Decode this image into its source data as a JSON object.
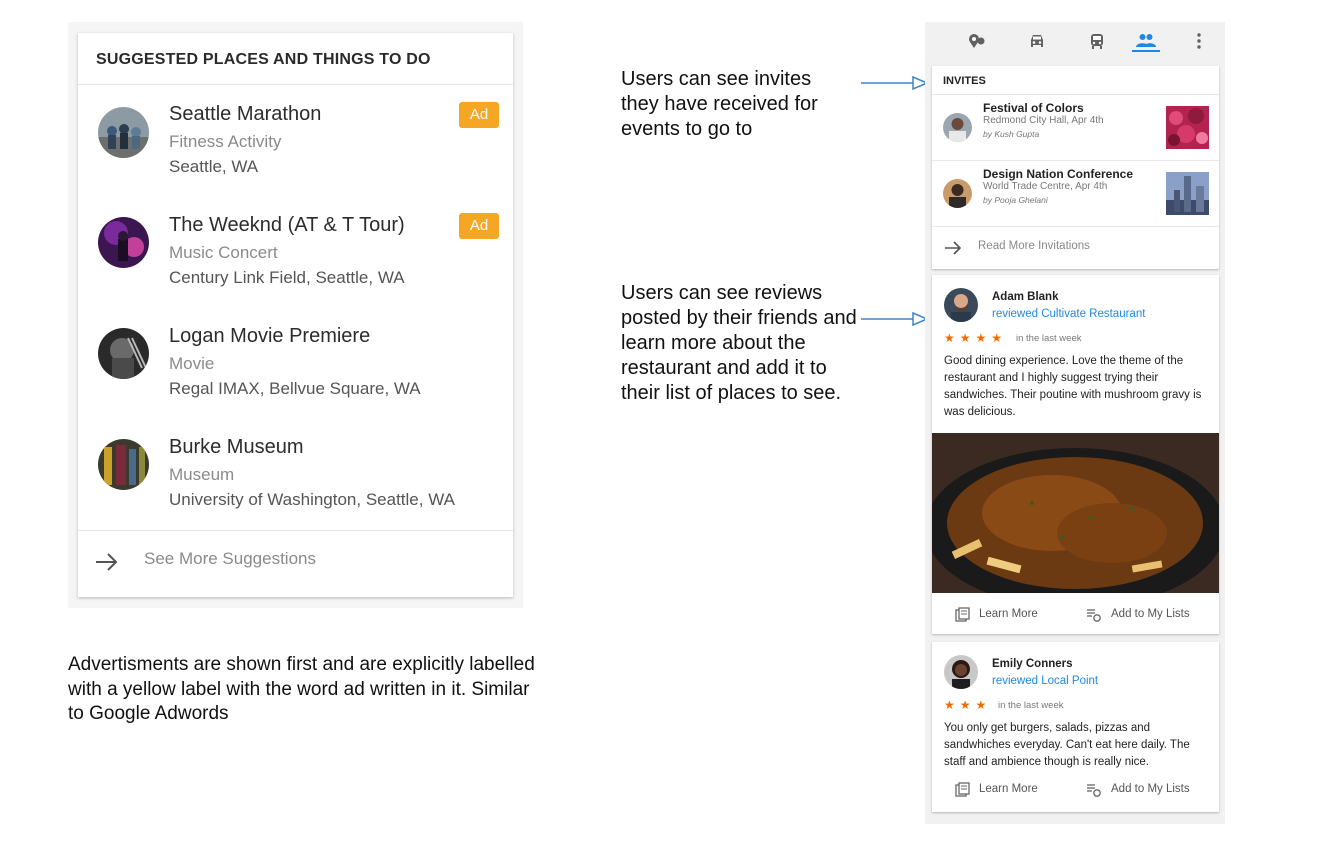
{
  "suggestions": {
    "header": "SUGGESTED PLACES AND THINGS TO DO",
    "items": [
      {
        "title": "Seattle Marathon",
        "category": "Fitness Activity",
        "location": "Seattle, WA",
        "badge": "Ad"
      },
      {
        "title": "The Weeknd (AT & T Tour)",
        "category": "Music Concert",
        "location": "Century Link Field, Seattle, WA",
        "badge": "Ad"
      },
      {
        "title": "Logan Movie Premiere",
        "category": "Movie",
        "location": "Regal IMAX, Bellvue Square, WA"
      },
      {
        "title": "Burke Museum",
        "category": "Museum",
        "location": "University of Washington, Seattle, WA"
      }
    ],
    "footer_label": "See More Suggestions",
    "footer_icon": "arrow-right-icon"
  },
  "notes": {
    "ads": "Advertisments are shown first and are explicitly labelled with a yellow label with the word ad written in it. Similar to Google Adwords",
    "invites": "Users can see invites they have received for events to go to",
    "reviews": "Users can see reviews posted by their friends and learn more about the restaurant and add it to their list of places to see."
  },
  "nav": {
    "icons": [
      "places-icon",
      "car-icon",
      "transit-icon",
      "people-icon",
      "more-vert-icon"
    ],
    "active": "people-icon"
  },
  "invites": {
    "header": "INVITES",
    "items": [
      {
        "title": "Festival of Colors",
        "place": "Redmond City Hall, Apr 4th",
        "by": "by Kush Gupta"
      },
      {
        "title": "Design Nation Conference",
        "place": "World Trade Centre, Apr 4th",
        "by": "by Pooja Ghelani"
      }
    ],
    "more_label": "Read More Invitations"
  },
  "reviews": [
    {
      "name": "Adam Blank",
      "action": "reviewed Cultivate Restaurant",
      "stars": 4,
      "when": "in the last week",
      "body": "Good dining experience. Love the theme of the restaurant and I highly suggest trying their sandwiches. Their poutine with mushroom gravy is was delicious.",
      "learn_more": "Learn More",
      "add_to_lists": "Add to My Lists"
    },
    {
      "name": "Emily Conners",
      "action": "reviewed Local Point",
      "stars": 3,
      "when": "in the last week",
      "body": "You only get burgers, salads, pizzas and sandwhiches everyday. Can't eat here daily. The staff and ambience though is really nice.",
      "learn_more": "Learn More",
      "add_to_lists": "Add to My Lists"
    }
  ],
  "colors": {
    "ad_badge": "#f5a623",
    "accent_blue": "#1e88e5",
    "star_orange": "#ef6c00"
  }
}
